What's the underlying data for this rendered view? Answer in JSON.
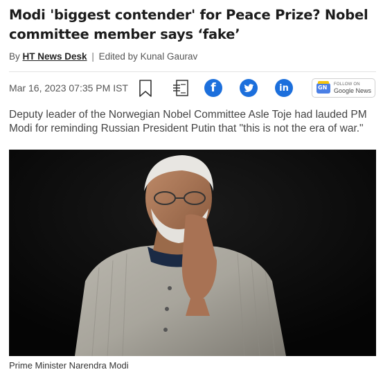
{
  "article": {
    "headline": "Modi 'biggest contender' for Peace Prize? Nobel committee member says ‘fake’",
    "byline_prefix": "By",
    "author": "HT News Desk",
    "separator": "|",
    "edited_by": "Edited by Kunal Gaurav",
    "date": "Mar 16, 2023 07:35 PM IST",
    "summary": "Deputy leader of the Norwegian Nobel Committee Asle Toje had lauded PM Modi for reminding Russian President Putin that \"this is not the era of war.\"",
    "image_caption": "Prime Minister Narendra Modi"
  },
  "share": {
    "google_news_follow": "FOLLOW ON",
    "google_news_label": "Google News",
    "google_news_logo": "GN",
    "icons": [
      "bookmark-icon",
      "share-icon",
      "facebook-icon",
      "twitter-icon",
      "linkedin-icon"
    ],
    "brand_color": "#1c6fdc"
  }
}
